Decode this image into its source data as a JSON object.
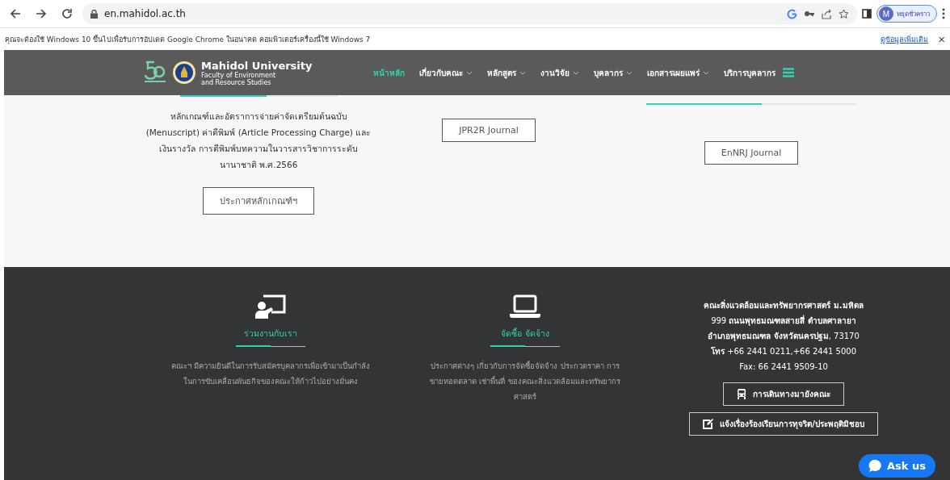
{
  "browser": {
    "url": "en.mahidol.ac.th",
    "profile_initial": "M",
    "profile_label": "หยุดชั่วคราว"
  },
  "infobar": {
    "message": "คุณจะต้องใช้ Windows 10 ขึ้นไปเพื่อรับการอัปเดต Google Chrome ในอนาคต คอมพิวเตอร์เครื่องนี้ใช้ Windows 7",
    "link": "ดูข้อมูลเพิ่มเติม",
    "close": "×"
  },
  "site_nav": {
    "logo_title": "Mahidol University",
    "logo_subtitle_1": "Faculty of Environment",
    "logo_subtitle_2": "and Resource Studies",
    "items": [
      {
        "label": "หน้าหลัก",
        "selected": true,
        "has_menu": false
      },
      {
        "label": "เกี่ยวกับคณะ",
        "selected": false,
        "has_menu": true
      },
      {
        "label": "หลักสูตร",
        "selected": false,
        "has_menu": true
      },
      {
        "label": "งานวิจัย",
        "selected": false,
        "has_menu": true
      },
      {
        "label": "บุคลากร",
        "selected": false,
        "has_menu": true
      },
      {
        "label": "เอกสารเผยแพร่",
        "selected": false,
        "has_menu": true
      },
      {
        "label": "บริการบุคลากร",
        "selected": false,
        "has_menu": false
      }
    ]
  },
  "content_columns": [
    {
      "text": "หลักเกณฑ์และอัตราการจ่ายค่าจัดเตรียมต้นฉบับ (Menuscript) ค่าตีพิมพ์ (Article Processing Charge) และเงินรางวัล การตีพิมพ์บทความในวารสารวิชาการระดับนานาชาติ พ.ศ.2566",
      "button": "ประกาศหลักเกณฑ์ฯ"
    },
    {
      "button": "JPR2R Journal"
    },
    {
      "button": "EnNRJ Journal"
    }
  ],
  "footer": {
    "columns": [
      {
        "kind": "join",
        "title": "ร่วมงานกับเรา",
        "text": "คณะฯ มีความยินดีในการรับสมัครบุคลากรเพื่อเข้ามาเป็นกำลังในการขับเคลื่อนพันธกิจของคณะให้ก้าวไปอย่างมั่นคง"
      },
      {
        "kind": "procurement",
        "title": "จัดซื้อ จัดจ้าง",
        "text": "ประกาศต่างๆ เกี่ยวกับการจัดซื้อจัดจ้าง ประกวดราคา การขายทอดตลาด เช่าพื้นที่ ของคณะสิ่งแวดล้อมและทรัพยากรศาสตร์"
      }
    ],
    "address_lines": [
      "**คณะสิ่งแวดล้อมและทรัพยากรศาสตร์ ม.มหิดล**",
      "999 **ถนนพุทธมณฑลสายสี่ ตำบลศาลายา**",
      "**อำเภอพุทธมณฑล จังหวัดนครปฐม**, 73170",
      "**โทร** +66 2441 0211,+66 2441 5000",
      "Fax: 66 2441 9509-10"
    ],
    "buttons": [
      {
        "kind": "bus",
        "label": "การเดินทางมายังคณะ"
      },
      {
        "kind": "report",
        "label": "แจ้งเรื่องร้องเรียนการทุจริต/ประพฤติมิชอบ"
      }
    ]
  },
  "chat_button": {
    "label": "Ask us"
  }
}
